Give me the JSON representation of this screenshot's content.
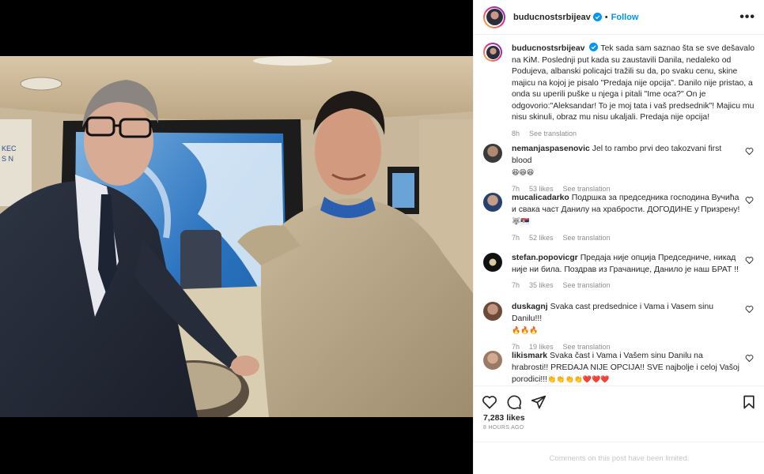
{
  "post": {
    "username": "buducnostsrbijeav",
    "follow_label": "Follow",
    "dot": "•",
    "more_label": "•••",
    "caption": "Tek sada sam saznao šta se sve dešavalo na KiM. Poslednji put kada su zaustavili Danila, nedaleko od Podujeva, albanski policajci tražili su da, po svaku cenu, skine majicu na kojoj je pisalo \"Predaja nije opcija\". Danilo nije pristao, a onda su uperili puške u njega i pitali \"Ime oca?\" On je odgovorio:\"Aleksandar! To je moj tata i vaš predsednik\"! Majicu mu nisu skinuli, obraz mu nisu ukaljali. Predaja nije opcija!",
    "caption_time": "8h",
    "see_translation": "See translation",
    "likes": "7,283 likes",
    "time_ago": "8 HOURS AGO",
    "comments_limited": "Comments on this post have been limited."
  },
  "comments": [
    {
      "user": "nemanjaspasenovic",
      "text": "Jel to rambo prvi deo takozvani first blood",
      "emoji": "😆😆😆",
      "time": "7h",
      "likes": "53 likes",
      "translate": "See translation"
    },
    {
      "user": "mucalicadarko",
      "text": "Подршка за председника господина Вучића и свака част Данилу на храбрости. ДОГОДИНЕ у Призрену!",
      "emoji": "🐺🇷🇸",
      "time": "7h",
      "likes": "52 likes",
      "translate": "See translation"
    },
    {
      "user": "stefan.popovicgr",
      "text": "Предаја није опција Председниче, никад није ни била. Поздрав из Грачанице, Данило је наш БРАТ !!",
      "emoji": "",
      "time": "7h",
      "likes": "35 likes",
      "translate": "See translation"
    },
    {
      "user": "duskagnj",
      "text": "Svaka cast predsednice i Vama i Vasem sinu Danilu!!!",
      "emoji": "🔥🔥🔥",
      "time": "7h",
      "likes": "19 likes",
      "translate": "See translation"
    },
    {
      "user": "likismark",
      "text": "Svaka čast i Vama i Vašem sinu Danilu na hrabrosti!! PREDAJA NIJE OPCIJA!! SVE najbolje i celoj Vašoj porodici!!!",
      "emoji": "👏👏👏👏❤️❤️❤️",
      "time": "",
      "likes": "",
      "translate": ""
    }
  ],
  "icons": [
    "verified-badge-icon",
    "heart-icon",
    "comment-icon",
    "share-icon",
    "bookmark-icon",
    "more-options-icon"
  ],
  "colors": {
    "link": "#0095f6",
    "text": "#262626",
    "muted": "#8e8e8e",
    "border": "#efefef"
  }
}
